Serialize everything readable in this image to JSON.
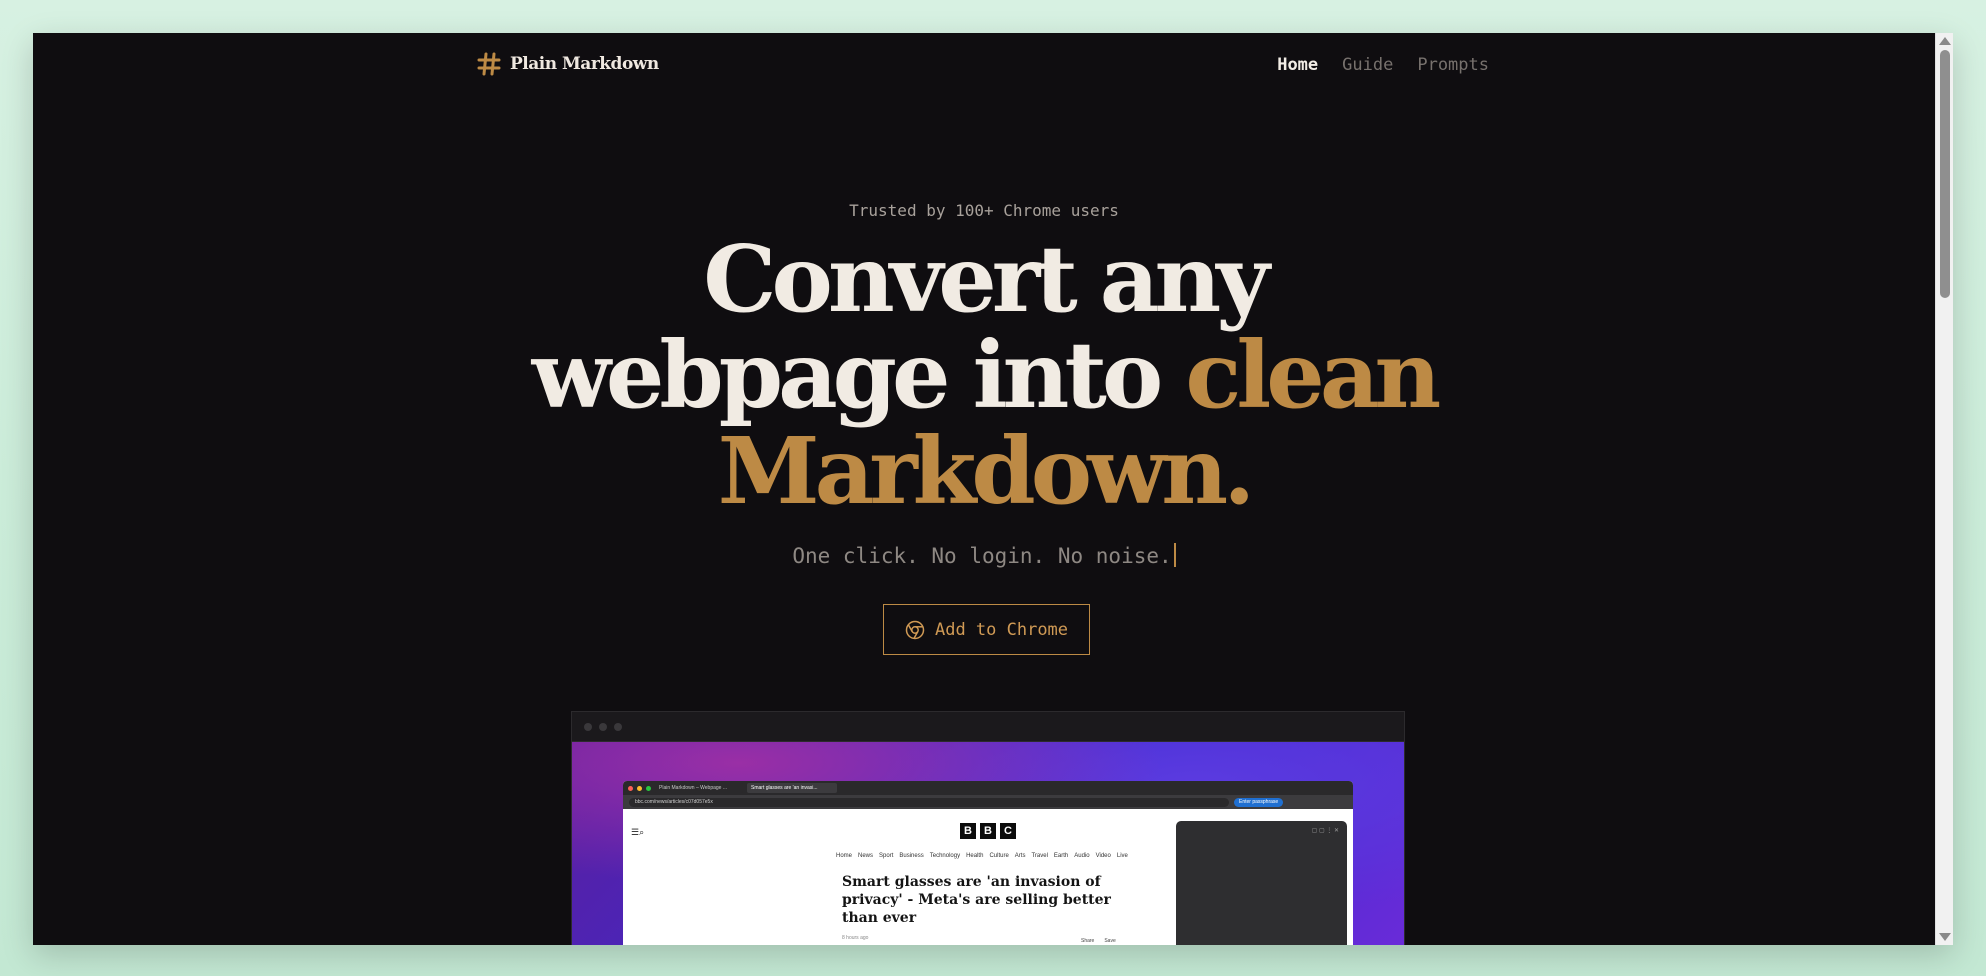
{
  "nav": {
    "logo_text": "Plain Markdown",
    "links": [
      {
        "label": "Home",
        "active": true
      },
      {
        "label": "Guide",
        "active": false
      },
      {
        "label": "Prompts",
        "active": false
      }
    ]
  },
  "hero": {
    "eyebrow": "Trusted by 100+ Chrome users",
    "title_line1": "Convert any",
    "title_line2a": "webpage into ",
    "title_line2b": "clean",
    "title_line3": "Markdown.",
    "subtitle": "One click. No login. No noise.",
    "cta_label": "Add to Chrome"
  },
  "demo": {
    "mini_tab1": "Plain Markdown – Webpage ...",
    "mini_tab2": "Smart glasses are 'an invasi...",
    "mini_url": "bbc.com/news/articles/c07d057e5x",
    "mini_pill": "Enter passphrase",
    "bbc_letters": [
      "B",
      "B",
      "C"
    ],
    "mini_nav": [
      "Home",
      "News",
      "Sport",
      "Business",
      "Technology",
      "Health",
      "Culture",
      "Arts",
      "Travel",
      "Earth",
      "Audio",
      "Video",
      "Live"
    ],
    "headline": "Smart glasses are 'an invasion of privacy' - Meta's are selling better than ever",
    "time": "8 hours ago",
    "share": "Share",
    "save": "Save"
  },
  "colors": {
    "accent": "#bd8a45",
    "background": "#0f0d10",
    "text": "#f1ebe3"
  }
}
